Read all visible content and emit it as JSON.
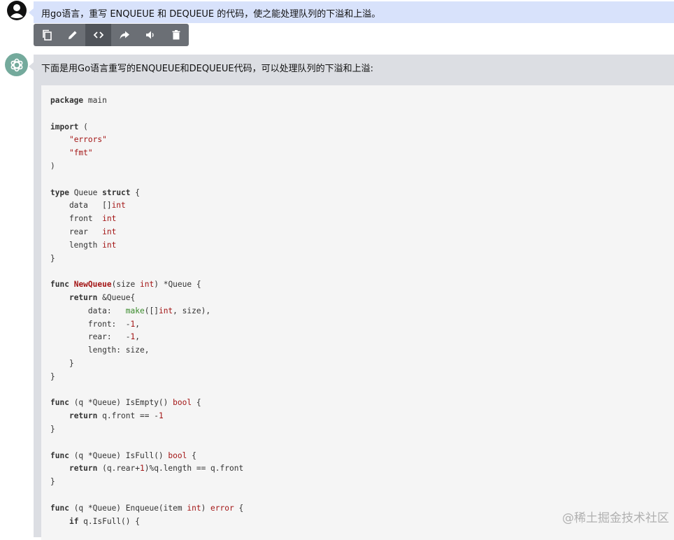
{
  "user": {
    "message": "用go语言，重写 ENQUEUE 和 DEQUEUE 的代码，使之能处理队列的下溢和上溢。"
  },
  "toolbar": {
    "icons": [
      "copy-icon",
      "edit-icon",
      "code-icon",
      "share-icon",
      "speaker-icon",
      "trash-icon"
    ],
    "active": "code-icon"
  },
  "assistant": {
    "intro": "下面是用Go语言重写的ENQUEUE和DEQUEUE代码，可以处理队列的下溢和上溢:"
  },
  "code_lines": [
    "package main",
    "",
    "import (",
    "    \"errors\"",
    "    \"fmt\"",
    ")",
    "",
    "type Queue struct {",
    "    data   []int",
    "    front  int",
    "    rear   int",
    "    length int",
    "}",
    "",
    "func NewQueue(size int) *Queue {",
    "    return &Queue{",
    "        data:   make([]int, size),",
    "        front:  -1,",
    "        rear:   -1,",
    "        length: size,",
    "    }",
    "}",
    "",
    "func (q *Queue) IsEmpty() bool {",
    "    return q.front == -1",
    "}",
    "",
    "func (q *Queue) IsFull() bool {",
    "    return (q.rear+1)%q.length == q.front",
    "}",
    "",
    "func (q *Queue) Enqueue(item int) error {",
    "    if q.IsFull() {"
  ],
  "watermark": "@稀土掘金技术社区",
  "colors": {
    "user_bubble": "#d8e2fb",
    "assistant_bubble": "#dcdee3",
    "code_background": "#f5f5f5",
    "toolbar": "#6b6f75",
    "bot_avatar": "#74aa9c"
  }
}
